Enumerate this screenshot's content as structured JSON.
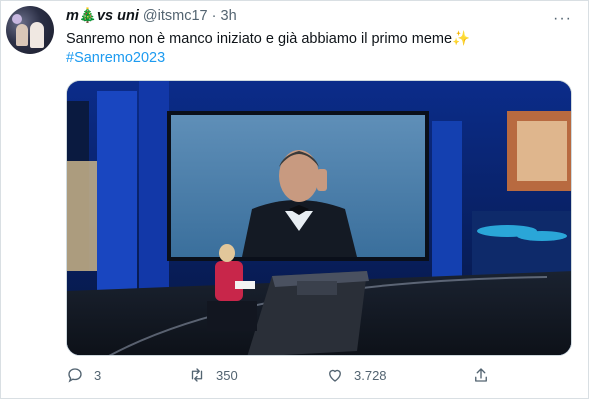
{
  "tweet": {
    "display_name": "m",
    "name_emoji": "🎄",
    "name_suffix": "vs uni",
    "handle": "@itsmc17",
    "separator": "·",
    "time": "3h",
    "text": "Sanremo non è manco iniziato e già abbiamo il primo meme✨",
    "hashtag": "#Sanremo2023",
    "more_label": "···"
  },
  "actions": {
    "reply_count": "3",
    "retweet_count": "350",
    "like_count": "3.728"
  },
  "icons": {
    "reply": "reply-icon",
    "retweet": "retweet-icon",
    "like": "heart-icon",
    "share": "share-icon",
    "more": "more-icon"
  },
  "colors": {
    "hashtag": "#1d9bf0",
    "secondary_text": "#536471",
    "studio_blue": "#1a4fc4"
  }
}
